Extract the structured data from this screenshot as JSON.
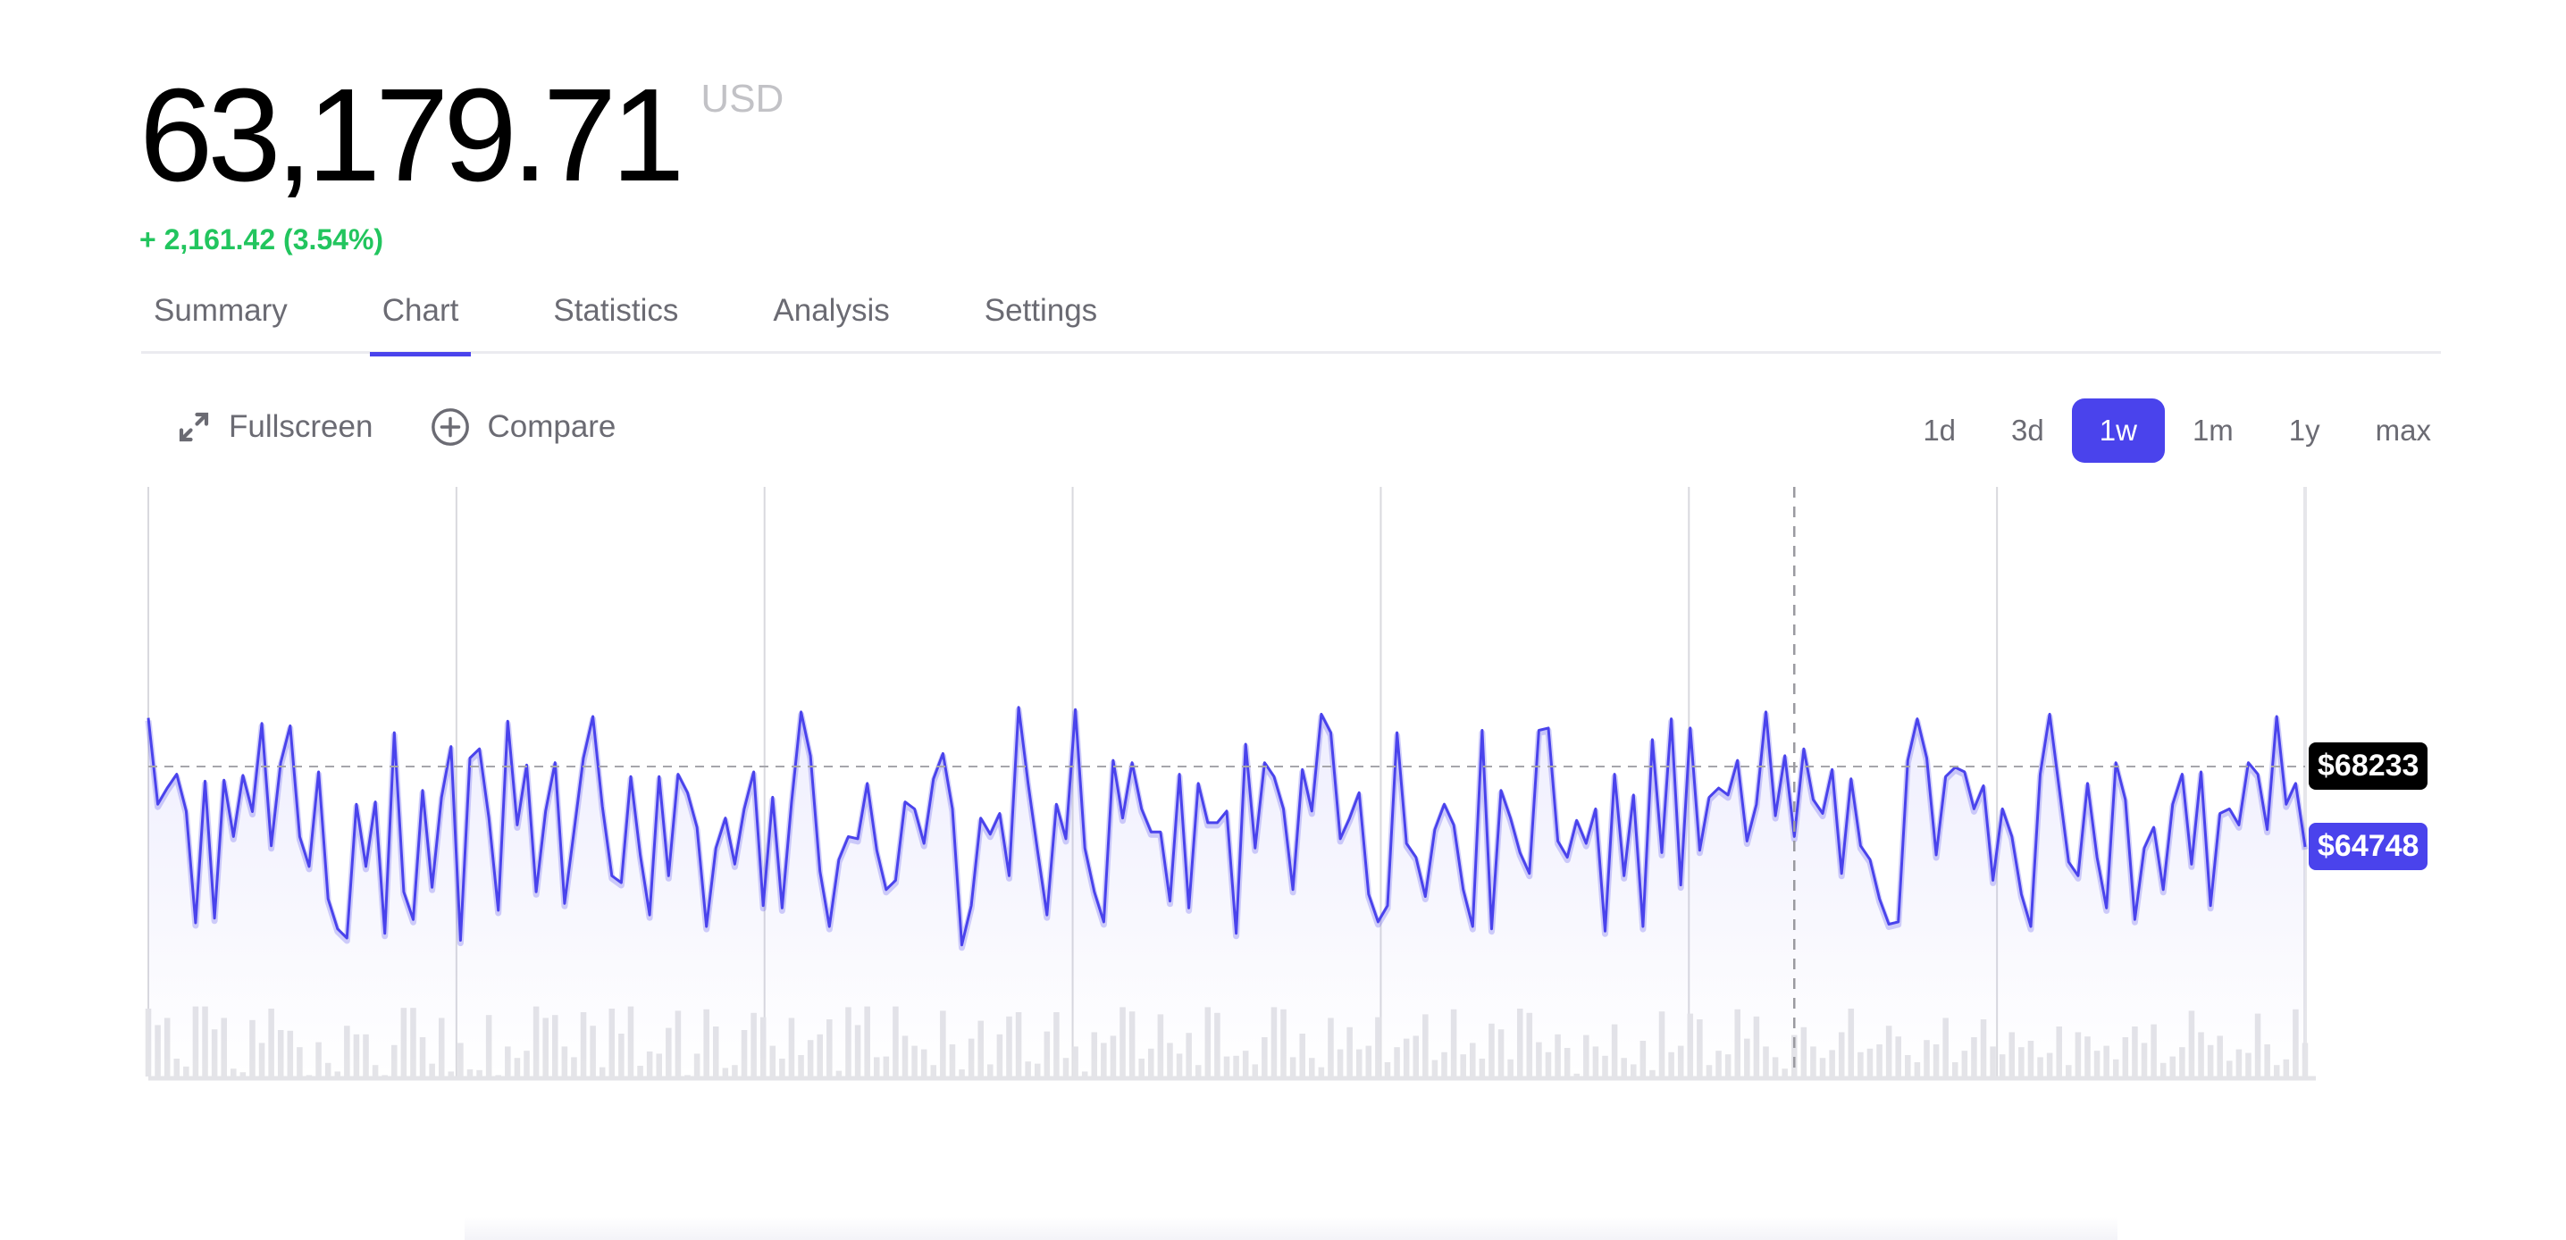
{
  "header": {
    "price": "63,179.71",
    "currency": "USD",
    "change": "+ 2,161.42 (3.54%)",
    "change_color": "#22c55e"
  },
  "tabs": [
    {
      "label": "Summary",
      "active": false
    },
    {
      "label": "Chart",
      "active": true
    },
    {
      "label": "Statistics",
      "active": false
    },
    {
      "label": "Analysis",
      "active": false
    },
    {
      "label": "Settings",
      "active": false
    }
  ],
  "toolbar": {
    "fullscreen_label": "Fullscreen",
    "fullscreen_icon": "expand-arrows-icon",
    "compare_label": "Compare",
    "compare_icon": "plus-circle-icon"
  },
  "ranges": [
    {
      "label": "1d",
      "active": false
    },
    {
      "label": "3d",
      "active": false
    },
    {
      "label": "1w",
      "active": true
    },
    {
      "label": "1m",
      "active": false
    },
    {
      "label": "1y",
      "active": false
    },
    {
      "label": "max",
      "active": false
    }
  ],
  "colors": {
    "accent": "#4a43ec",
    "line": "#4a43ec",
    "volume": "#e4e4e8",
    "grid": "#d9d9de",
    "reference_badge": "#000000"
  },
  "chart_data": {
    "type": "line",
    "title": "",
    "xlabel": "",
    "ylabel": "",
    "ylim": [
      54800,
      80350
    ],
    "grid": "vertical",
    "vertical_gridlines": 7,
    "crosshair_index": 174,
    "reference_line": {
      "value": 68233,
      "label": "$68233",
      "style": "dashed"
    },
    "last_value": {
      "value": 64748,
      "label": "$64748"
    },
    "series": [
      {
        "name": "price",
        "values": [
          70340,
          66600,
          67300,
          67900,
          66300,
          61460,
          67600,
          61660,
          67640,
          65200,
          67850,
          66280,
          70100,
          64800,
          68400,
          70000,
          65200,
          63900,
          68000,
          62500,
          61200,
          60800,
          66600,
          63900,
          66700,
          61000,
          69700,
          62800,
          61600,
          67200,
          63000,
          66900,
          69100,
          60700,
          68600,
          69000,
          66000,
          62000,
          70200,
          65700,
          68300,
          62800,
          66300,
          68400,
          62300,
          65400,
          68600,
          70400,
          66500,
          63500,
          63200,
          67800,
          64400,
          61800,
          67800,
          63500,
          67900,
          67100,
          65600,
          61300,
          64700,
          66000,
          64000,
          66400,
          68000,
          62200,
          66900,
          62100,
          66700,
          70600,
          68700,
          63700,
          61300,
          64200,
          65200,
          65100,
          67500,
          64600,
          62900,
          63300,
          66700,
          66400,
          64900,
          67700,
          68800,
          66400,
          60500,
          62200,
          66000,
          65300,
          66200,
          63500,
          70800,
          67500,
          64600,
          61800,
          66600,
          65100,
          70700,
          64700,
          62800,
          61500,
          68500,
          66000,
          68400,
          66400,
          65400,
          65400,
          62400,
          67900,
          62100,
          67500,
          65800,
          65800,
          66300,
          61000,
          69200,
          64700,
          68400,
          67800,
          66400,
          62900,
          68100,
          66300,
          70500,
          69700,
          65100,
          66000,
          67100,
          62700,
          61500,
          62200,
          69700,
          64900,
          64300,
          62600,
          65500,
          66600,
          65700,
          62900,
          61300,
          69800,
          61200,
          67200,
          66000,
          64500,
          63600,
          69800,
          69900,
          65000,
          64300,
          65900,
          64900,
          66400,
          61100,
          67900,
          63500,
          67000,
          61300,
          69400,
          64500,
          70300,
          63100,
          69900,
          64600,
          66900,
          67300,
          67000,
          68500,
          65000,
          66600,
          70600,
          66100,
          68700,
          65200,
          69000,
          66800,
          66200,
          68100,
          63600,
          67700,
          64800,
          64200,
          62500,
          61400,
          61500,
          68500,
          70300,
          68600,
          64400,
          67800,
          68200,
          68000,
          66400,
          67400,
          63300,
          66400,
          65200,
          62700,
          61300,
          67900,
          70500,
          67300,
          64100,
          63500,
          67500,
          64300,
          62100,
          68400,
          66800,
          61600,
          64700,
          65600,
          62900,
          66600,
          67900,
          64000,
          68000,
          62200,
          66200,
          66400,
          65700,
          68400,
          67900,
          65500,
          70400,
          66600,
          67500,
          64748
        ]
      },
      {
        "name": "volume",
        "values": [
          0.95,
          0.72,
          0.82,
          0.25,
          0.14,
          0.98,
          0.98,
          0.66,
          0.82,
          0.11,
          0.06,
          0.79,
          0.47,
          0.95,
          0.65,
          0.64,
          0.41,
          0.02,
          0.48,
          0.19,
          0.07,
          0.71,
          0.59,
          0.59,
          0.16,
          0.02,
          0.44,
          0.96,
          0.96,
          0.55,
          0.18,
          0.82,
          0.07,
          0.47,
          0.1,
          0.09,
          0.86,
          0.02,
          0.42,
          0.26,
          0.36,
          0.98,
          0.82,
          0.86,
          0.42,
          0.27,
          0.9,
          0.71,
          0.13,
          0.95,
          0.6,
          0.98,
          0.15,
          0.35,
          0.32,
          0.68,
          0.92,
          0.02,
          0.32,
          0.94,
          0.7,
          0.12,
          0.16,
          0.65,
          0.89,
          0.83,
          0.43,
          0.25,
          0.82,
          0.3,
          0.51,
          0.59,
          0.8,
          0.08,
          0.97,
          0.72,
          0.98,
          0.27,
          0.28,
          0.98,
          0.57,
          0.43,
          0.38,
          0.16,
          0.92,
          0.45,
          0.1,
          0.53,
          0.78,
          0.17,
          0.59,
          0.84,
          0.9,
          0.21,
          0.18,
          0.63,
          0.9,
          0.26,
          0.42,
          0.07,
          0.62,
          0.47,
          0.57,
          0.97,
          0.91,
          0.25,
          0.39,
          0.87,
          0.47,
          0.32,
          0.61,
          0.16,
          0.97,
          0.89,
          0.28,
          0.29,
          0.36,
          0.17,
          0.55,
          0.97,
          0.94,
          0.27,
          0.6,
          0.26,
          0.13,
          0.82,
          0.38,
          0.69,
          0.38,
          0.43,
          0.83,
          0.2,
          0.41,
          0.53,
          0.57,
          0.87,
          0.23,
          0.34,
          0.94,
          0.31,
          0.47,
          0.25,
          0.74,
          0.66,
          0.24,
          0.95,
          0.89,
          0.48,
          0.34,
          0.59,
          0.4,
          0.04,
          0.58,
          0.42,
          0.29,
          0.73,
          0.26,
          0.17,
          0.5,
          0.09,
          0.91,
          0.34,
          0.43,
          0.88,
          0.8,
          0.16,
          0.36,
          0.31,
          0.94,
          0.53,
          0.84,
          0.42,
          0.27,
          0.11,
          0.58,
          0.69,
          0.42,
          0.26,
          0.37,
          0.62,
          0.95,
          0.34,
          0.39,
          0.45,
          0.71,
          0.56,
          0.3,
          0.2,
          0.51,
          0.45,
          0.82,
          0.2,
          0.36,
          0.55,
          0.8,
          0.42,
          0.31,
          0.62,
          0.41,
          0.5,
          0.27,
          0.33,
          0.7,
          0.16,
          0.62,
          0.56,
          0.36,
          0.43,
          0.24,
          0.55,
          0.7,
          0.47,
          0.73,
          0.19,
          0.28,
          0.41,
          0.92,
          0.62,
          0.44,
          0.57,
          0.22,
          0.38,
          0.33,
          0.88,
          0.45,
          0.16,
          0.24,
          0.94,
          0.47
        ]
      }
    ]
  }
}
